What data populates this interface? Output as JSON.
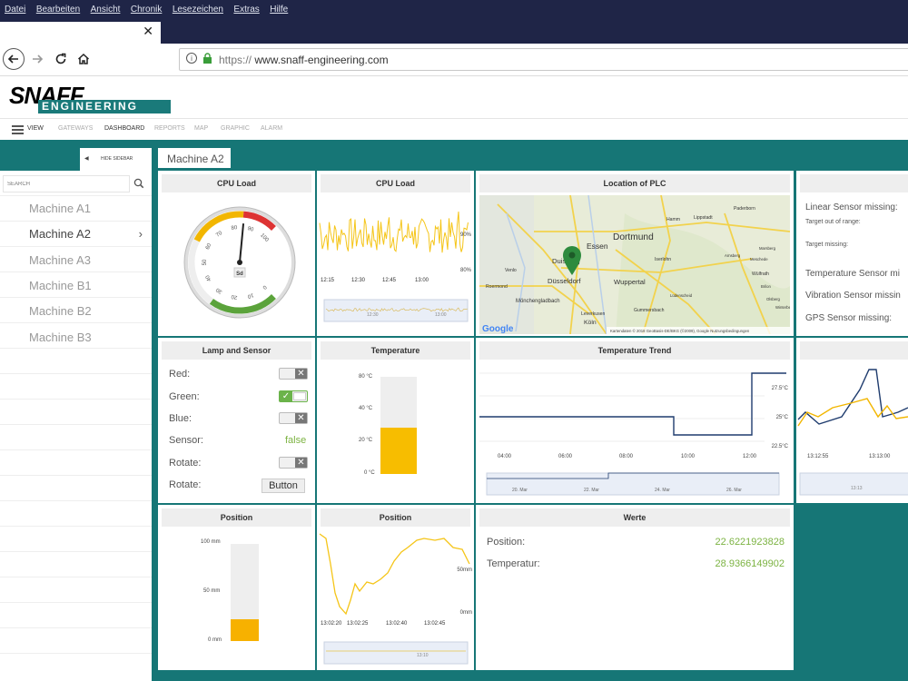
{
  "browser": {
    "menu": [
      "Datei",
      "Bearbeiten",
      "Ansicht",
      "Chronik",
      "Lesezeichen",
      "Extras",
      "Hilfe"
    ],
    "url_protocol": "https://",
    "url_host": "www.snaff-engineering.com"
  },
  "logo": {
    "main": "SNAFF",
    "sub": "ENGINEERING"
  },
  "nav": {
    "view": "VIEW",
    "items": [
      "GATEWAYS",
      "DASHBOARD",
      "REPORTS",
      "MAP",
      "GRAPHIC",
      "ALARM"
    ],
    "active": "DASHBOARD"
  },
  "sidebar": {
    "hide_label": "HIDE SIDEBAR",
    "search_placeholder": "SEARCH",
    "machines": [
      "Machine A1",
      "Machine A2",
      "Machine A3",
      "Machine B1",
      "Machine B2",
      "Machine B3"
    ],
    "active": "Machine A2"
  },
  "machine_tab": "Machine A2",
  "panels": {
    "cpu_gauge": {
      "title": "CPU Load",
      "value": 52,
      "ticks": [
        "0",
        "10",
        "20",
        "30",
        "40",
        "50",
        "60",
        "70",
        "80",
        "90",
        "100"
      ],
      "center_label": "Sd"
    },
    "cpu_chart": {
      "title": "CPU Load",
      "y_top": "90%",
      "y_bottom": "80%",
      "x_ticks": [
        "12:15",
        "12:30",
        "12:45",
        "13:00"
      ],
      "nav_ticks": [
        "12:30",
        "13:00"
      ]
    },
    "map": {
      "title": "Location of PLC",
      "cities": [
        "Essen",
        "Dortmund",
        "Duisburg",
        "Düsseldorf",
        "Wuppertal",
        "Hamm",
        "Lippstadt",
        "Paderborn",
        "Iserlohn",
        "Mönchengladbach",
        "Leverkusen",
        "Köln",
        "Gummersbach",
        "Venlo",
        "Roermond",
        "Wülfrath",
        "Arnsberg",
        "Brilon",
        "Olsberg",
        "Meschede",
        "Winterberg",
        "Lüdenscheid",
        "Marsberg"
      ],
      "attribution": "Kartendaten © 2018 GeoBasis-DE/BKG (©2009), Google   Nutzungsbedingungen",
      "google": "Google"
    },
    "alarms": {
      "linear": "Linear Sensor missing:",
      "target_out": "Target out of range:",
      "target_missing": "Target missing:",
      "temperature": "Temperature Sensor mi",
      "vibration": "Vibration Sensor missin",
      "gps": "GPS Sensor missing:"
    },
    "lamp": {
      "title": "Lamp and Sensor",
      "red": "Red:",
      "green": "Green:",
      "blue": "Blue:",
      "sensor": "Sensor:",
      "sensor_value": "false",
      "rotate": "Rotate:",
      "rotate2": "Rotate:",
      "button": "Button"
    },
    "temperature": {
      "title": "Temperature",
      "ticks": [
        "80 °C",
        "40 °C",
        "20 °C",
        "0 °C"
      ],
      "fill_fraction": 0.48
    },
    "trend": {
      "title": "Temperature Trend",
      "y_ticks": [
        "27.5°C",
        "25°C",
        "22.5°C"
      ],
      "x_ticks": [
        "04:00",
        "06:00",
        "08:00",
        "10:00",
        "12:00"
      ],
      "nav_ticks": [
        "20. Mar",
        "22. Mar",
        "24. Mar",
        "26. Mar"
      ]
    },
    "right_chart": {
      "x_ticks": [
        "13:12:55",
        "13:13:00"
      ],
      "nav_tick": "13:13"
    },
    "position_bar": {
      "title": "Position",
      "ticks": [
        "100 mm",
        "50 mm",
        "0 mm"
      ],
      "fill_fraction": 0.22
    },
    "position_chart": {
      "title": "Position",
      "y_top": "50mm",
      "y_bottom": "0mm",
      "x_ticks": [
        "13:02:20",
        "13:02:25",
        "13:02:40",
        "13:02:45"
      ],
      "nav_tick": "13:10"
    },
    "werte": {
      "title": "Werte",
      "position_label": "Position:",
      "position_value": "22.6221923828",
      "temp_label": "Temperatur:",
      "temp_value": "28.9366149902"
    }
  },
  "colors": {
    "teal": "#167676",
    "gauge_yellow": "#f2b600",
    "line_yellow": "#f5c518",
    "line_navy": "#1f3c6e",
    "green": "#7cb342",
    "red": "#d33"
  }
}
